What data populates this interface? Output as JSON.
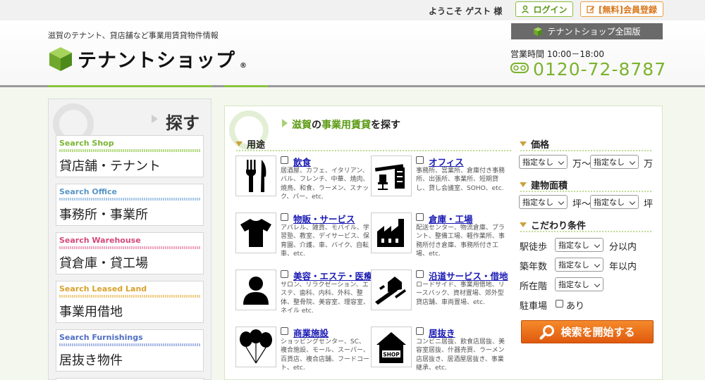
{
  "topbar": {
    "welcome": "ようこそ ゲスト 様",
    "login_label": "ログイン",
    "register_label": "[無料]会員登録"
  },
  "header": {
    "tagline": "滋賀のテナント、貸店舗など事業用賃貸物件情報",
    "logo_text": "テナントショップ",
    "national_label": "テナントショップ全国版",
    "hours": "営業時間 10:00－18:00",
    "phone": "0120-72-8787",
    "freedial": "フリーダイヤル"
  },
  "left": {
    "heading": "探す",
    "categories": [
      {
        "en": "Search Shop",
        "ja": "貸店舗・テナント",
        "color": "#7ab535"
      },
      {
        "en": "Search Office",
        "ja": "事務所・事業所",
        "color": "#5a96c8"
      },
      {
        "en": "Search Warehouse",
        "ja": "貸倉庫・貸工場",
        "color": "#d4487a"
      },
      {
        "en": "Search Leased Land",
        "ja": "事業用借地",
        "color": "#d8a22b"
      },
      {
        "en": "Search Furnishings",
        "ja": "居抜き物件",
        "color": "#4f6fc4"
      }
    ]
  },
  "main": {
    "title_pre": "滋賀",
    "title_mid1": "の",
    "title_hl": "事業用賃貸",
    "title_post": "を探す",
    "use_heading": "用途",
    "uses": [
      {
        "name": "飲食",
        "desc": "居酒屋、カフェ、イタリアン、バル、フレンチ、中華、焼肉、焼鳥、和食、ラーメン、スナック、バー、etc.",
        "icon": "fork-knife-icon"
      },
      {
        "name": "オフィス",
        "desc": "事務所、営業所、倉庫付き事務所、出張所、事業所、短期貸し、貸し会議室、SOHO、etc.",
        "icon": "office-desk-icon"
      },
      {
        "name": "物販・サービス",
        "desc": "アパレル、雑貨、モバイル、学習塾、教室、デイサービス、保育園、介護、車、バイク、自転車、etc.",
        "icon": "tshirt-icon"
      },
      {
        "name": "倉庫・工場",
        "desc": "配送センター、物流倉庫、プラント、整備工場、軽作業所、事務所付き倉庫、事務所付き工場、etc.",
        "icon": "factory-icon"
      },
      {
        "name": "美容・エステ・医療",
        "desc": "サロン、リラクゼーション、エステ、歯科、内科、外科、整体、整骨院、美容室、理容室、ネイル etc.",
        "icon": "person-icon"
      },
      {
        "name": "沿道サービス・借地",
        "desc": "ロードサイド、事業用借地、リースバック、資材置場、郊外型貸店舗、車両置場、etc.",
        "icon": "road-icon"
      },
      {
        "name": "商業施設",
        "desc": "ショッピングセンター、SC、複合施設、モール、スーパー、百貨店、複合店舗、フードコート、etc.",
        "icon": "balloons-icon"
      },
      {
        "name": "居抜き",
        "desc": "コンビニ居抜、飲食店居抜、美容室居抜、什器売買、ラーメン店居抜き、居酒屋居抜き、事業継承、etc.",
        "icon": "shop-icon"
      }
    ]
  },
  "filters": {
    "price_heading": "価格",
    "price_from": "指定なし",
    "price_sep": "万～",
    "price_to": "指定なし",
    "price_unit": "万",
    "area_heading": "建物面積",
    "area_from": "指定なし",
    "area_sep": "坪～",
    "area_to": "指定なし",
    "area_unit": "坪",
    "cond_heading": "こだわり条件",
    "walk_label": "駅徒歩",
    "walk_value": "指定なし",
    "walk_unit": "分以内",
    "age_label": "築年数",
    "age_value": "指定なし",
    "age_unit": "年以内",
    "floor_label": "所在階",
    "floor_value": "指定なし",
    "parking_label": "駐車場",
    "parking_option": "あり",
    "search_button": "検索を開始する"
  }
}
